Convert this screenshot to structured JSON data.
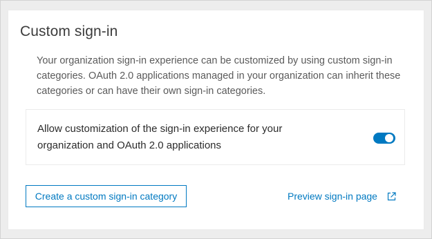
{
  "section": {
    "title": "Custom sign-in",
    "description": "Your organization sign-in experience can be customized by using custom sign-in categories. OAuth 2.0 applications managed in your organization can inherit these categories or can have their own sign-in categories."
  },
  "toggle": {
    "label": "Allow customization of the sign-in experience for your organization and OAuth 2.0 applications",
    "checked": true
  },
  "actions": {
    "create_button_label": "Create a custom sign-in category",
    "preview_link_label": "Preview sign-in page",
    "preview_icon": "launch-icon"
  },
  "colors": {
    "accent": "#0079c1",
    "background": "#ededed",
    "card": "#ffffff"
  }
}
